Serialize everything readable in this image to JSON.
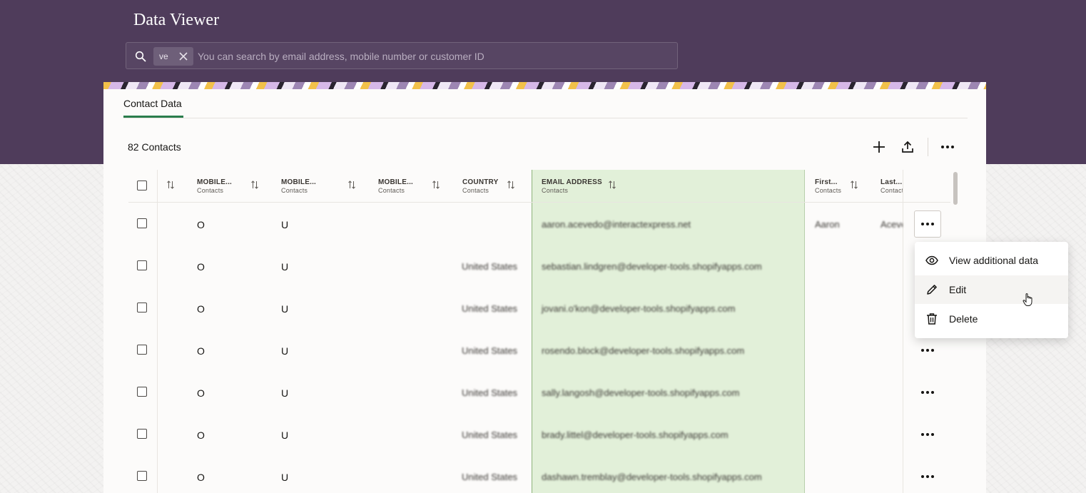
{
  "app": {
    "title": "Data Viewer"
  },
  "search": {
    "chip_text": "ve",
    "placeholder": "You can search by email address, mobile number or customer ID"
  },
  "tabs": [
    {
      "label": "Contact Data",
      "active": true
    }
  ],
  "toolbar": {
    "count_label": "82 Contacts"
  },
  "table": {
    "columns": [
      {
        "label": "MOBILE...",
        "sub": "Contacts"
      },
      {
        "label": "MOBILE...",
        "sub": "Contacts"
      },
      {
        "label": "MOBILE...",
        "sub": "Contacts"
      },
      {
        "label": "COUNTRY",
        "sub": "Contacts"
      },
      {
        "label": "EMAIL ADDRESS",
        "sub": "Contacts"
      },
      {
        "label": "First...",
        "sub": "Contacts"
      },
      {
        "label": "Last...",
        "sub": "Contacts"
      }
    ],
    "rows": [
      {
        "m1": "O",
        "m2": "U",
        "country": "",
        "email": "aaron.acevedo@interactexpress.net",
        "first": "Aaron",
        "last": "Aceve"
      },
      {
        "m1": "O",
        "m2": "U",
        "country": "United States",
        "email": "sebastian.lindgren@developer-tools.shopifyapps.com",
        "first": "",
        "last": ""
      },
      {
        "m1": "O",
        "m2": "U",
        "country": "United States",
        "email": "jovani.o'kon@developer-tools.shopifyapps.com",
        "first": "",
        "last": ""
      },
      {
        "m1": "O",
        "m2": "U",
        "country": "United States",
        "email": "rosendo.block@developer-tools.shopifyapps.com",
        "first": "",
        "last": ""
      },
      {
        "m1": "O",
        "m2": "U",
        "country": "United States",
        "email": "sally.langosh@developer-tools.shopifyapps.com",
        "first": "",
        "last": ""
      },
      {
        "m1": "O",
        "m2": "U",
        "country": "United States",
        "email": "brady.littel@developer-tools.shopifyapps.com",
        "first": "",
        "last": ""
      },
      {
        "m1": "O",
        "m2": "U",
        "country": "United States",
        "email": "dashawn.tremblay@developer-tools.shopifyapps.com",
        "first": "",
        "last": ""
      }
    ]
  },
  "context_menu": {
    "items": [
      {
        "label": "View additional data",
        "icon": "eye-icon"
      },
      {
        "label": "Edit",
        "icon": "pencil-icon"
      },
      {
        "label": "Delete",
        "icon": "trash-icon"
      }
    ]
  },
  "colors": {
    "banner": "#4f3c5b",
    "email_column_highlight": "#e2f0d9",
    "tab_accent": "#2a7d4c"
  }
}
